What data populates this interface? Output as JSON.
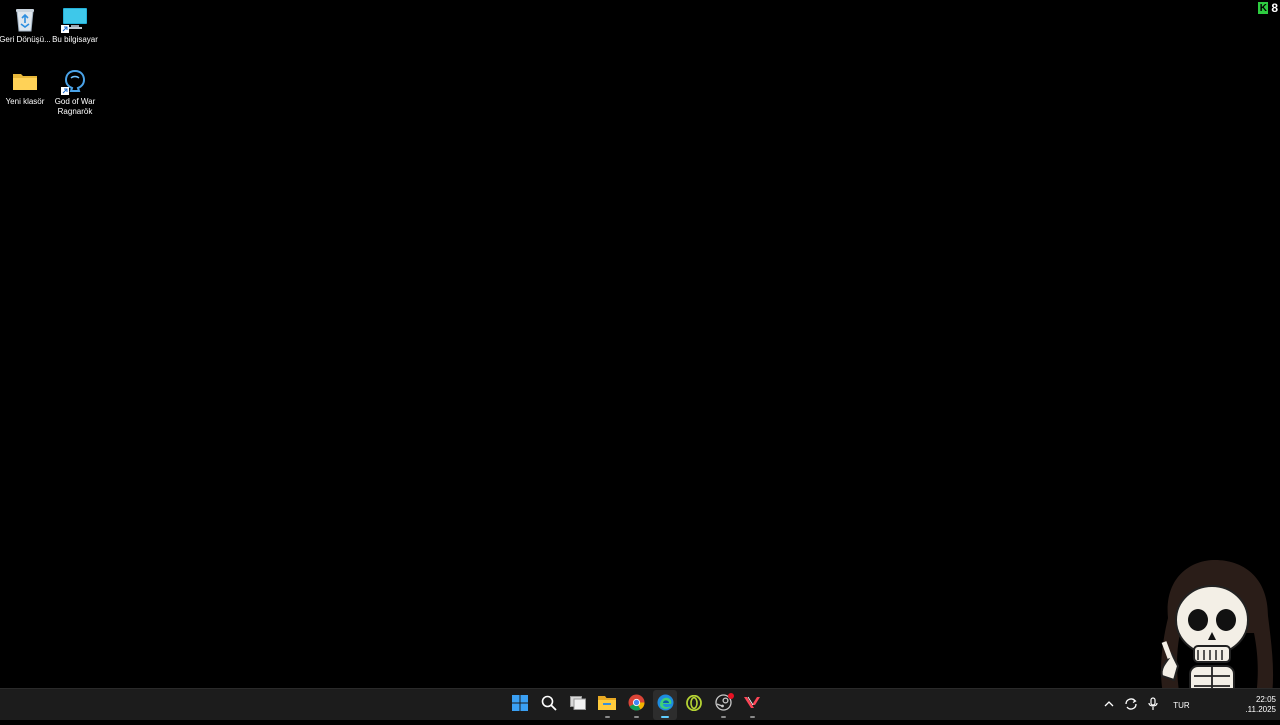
{
  "desktop": {
    "icons": [
      {
        "label": "Geri Dönüşü...",
        "icon": "recycle-bin-icon"
      },
      {
        "label": "Bu bilgisayar",
        "icon": "computer-icon"
      },
      {
        "label": "Yeni klasör",
        "icon": "folder-icon"
      },
      {
        "label": "God of War Ragnarök",
        "icon": "game-shortcut-icon"
      }
    ]
  },
  "top_badge": {
    "letter": "K",
    "value": "8",
    "color": "#2ecc40"
  },
  "taskbar": {
    "apps": [
      {
        "name": "Başlat",
        "icon": "windows-start-icon"
      },
      {
        "name": "Ara",
        "icon": "search-icon"
      },
      {
        "name": "Görev görünümü",
        "icon": "task-view-icon"
      },
      {
        "name": "Dosya Gezgini",
        "icon": "file-explorer-icon"
      },
      {
        "name": "Chrome",
        "icon": "chrome-icon"
      },
      {
        "name": "Edge",
        "icon": "edge-icon"
      },
      {
        "name": "Opera",
        "icon": "opera-icon"
      },
      {
        "name": "Steam",
        "icon": "steam-icon"
      },
      {
        "name": "Valorant",
        "icon": "valorant-icon"
      }
    ],
    "tray": {
      "language": "TUR",
      "time": "22:05",
      "date": ".11.2025"
    }
  },
  "colors": {
    "desktop_bg": "#000000",
    "taskbar_bg": "#1c1c1c",
    "accent": "#60cdff"
  }
}
